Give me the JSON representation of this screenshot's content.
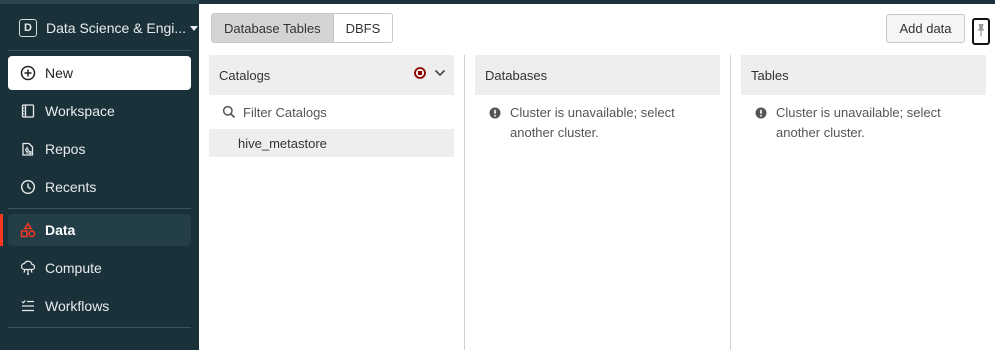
{
  "sidebar": {
    "workspace": {
      "badge": "D",
      "name": "Data Science & Engi..."
    },
    "new_label": "New",
    "items": [
      {
        "label": "Workspace",
        "icon": "workspace-icon"
      },
      {
        "label": "Repos",
        "icon": "repos-icon"
      },
      {
        "label": "Recents",
        "icon": "clock-icon"
      },
      {
        "label": "Data",
        "icon": "data-icon",
        "active": true
      },
      {
        "label": "Compute",
        "icon": "compute-icon"
      },
      {
        "label": "Workflows",
        "icon": "workflows-icon"
      }
    ]
  },
  "toolbar": {
    "tabs": [
      {
        "label": "Database Tables",
        "active": true
      },
      {
        "label": "DBFS",
        "active": false
      }
    ],
    "add_data_label": "Add data"
  },
  "panels": {
    "catalogs": {
      "title": "Catalogs",
      "filter_placeholder": "Filter Catalogs",
      "items": [
        "hive_metastore"
      ]
    },
    "databases": {
      "title": "Databases",
      "message": "Cluster is unavailable; select another cluster."
    },
    "tables": {
      "title": "Tables",
      "message": "Cluster is unavailable; select another cluster."
    }
  },
  "colors": {
    "sidebar_bg": "#1b3139",
    "accent_red": "#ff3621",
    "status_dark_red": "#8b0000"
  }
}
